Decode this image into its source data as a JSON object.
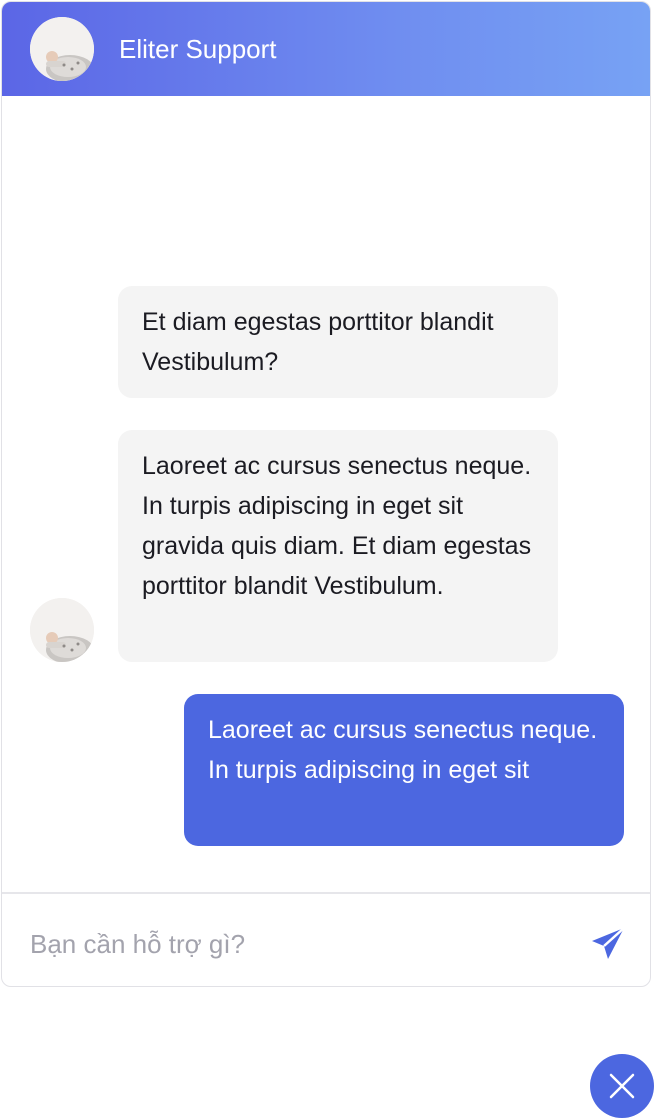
{
  "header": {
    "title": "Eliter Support",
    "avatar_icon": "support-agent-avatar"
  },
  "messages": [
    {
      "sender": "agent",
      "text": "Et diam egestas porttitor blandit Vestibulum?"
    },
    {
      "sender": "agent",
      "text": "Laoreet ac cursus senectus neque. In turpis adipiscing in eget sit gravida quis diam. Et diam egestas porttitor blandit Vestibulum."
    },
    {
      "sender": "user",
      "text": "Laoreet ac cursus senectus neque. In turpis adipiscing in eget sit"
    }
  ],
  "composer": {
    "placeholder": "Bạn cần hỗ trợ gì?",
    "value": "",
    "send_icon": "send-icon"
  },
  "fab": {
    "icon": "close-icon"
  },
  "colors": {
    "accent": "#4c67e0",
    "header_gradient_start": "#5b66e6",
    "header_gradient_end": "#77a2f4",
    "incoming_bubble": "#f4f4f4",
    "placeholder": "#a3a3ad"
  }
}
